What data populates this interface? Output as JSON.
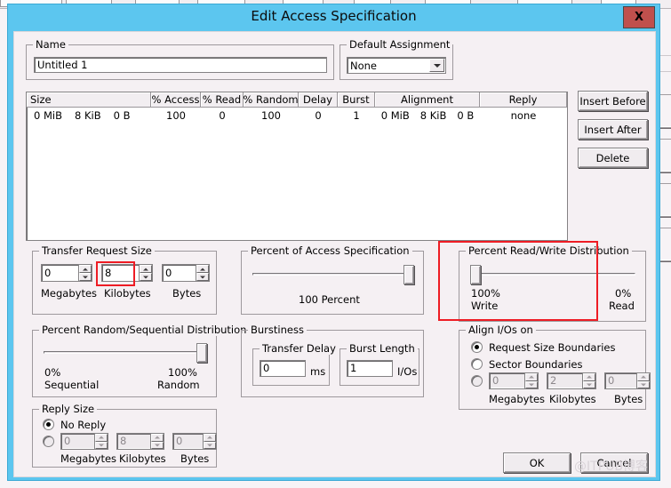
{
  "window": {
    "title": "Edit Access Specification",
    "close_label": "X",
    "titlebar_color": "#5cc6ef",
    "body_color": "#f5f0f3",
    "annotation_color": "#ee1c24",
    "close_button_color": "#c0504d"
  },
  "name_group": {
    "legend": "Name",
    "value": "Untitled 1"
  },
  "default_assignment_group": {
    "legend": "Default Assignment",
    "selected": "None",
    "options": [
      "None"
    ]
  },
  "spec_list": {
    "columns": [
      "Size",
      "% Access",
      "% Read",
      "% Random",
      "Delay",
      "Burst",
      "Alignment",
      "Reply"
    ],
    "rows": [
      {
        "size": [
          "0 MiB",
          "8 KiB",
          "0 B"
        ],
        "access": "100",
        "read": "0",
        "random": "100",
        "delay": "0",
        "burst": "1",
        "alignment": [
          "0 MiB",
          "8 KiB",
          "0 B"
        ],
        "reply": "none"
      }
    ]
  },
  "side_buttons": {
    "insert_before": "Insert Before",
    "insert_after": "Insert After",
    "delete": "Delete"
  },
  "transfer_request_size": {
    "legend": "Transfer Request Size",
    "megabytes_value": "0",
    "kilobytes_value": "8",
    "bytes_value": "0",
    "megabytes_label": "Megabytes",
    "kilobytes_label": "Kilobytes",
    "bytes_label": "Bytes"
  },
  "percent_of_access": {
    "legend": "Percent of Access Specification",
    "value_label": "100 Percent",
    "slider_percent": 100
  },
  "percent_read_write": {
    "legend": "Percent Read/Write Distribution",
    "left_percent": "100%",
    "left_label": "Write",
    "right_percent": "0%",
    "right_label": "Read",
    "slider_percent": 0
  },
  "percent_random_sequential": {
    "legend": "Percent Random/Sequential Distribution",
    "left_percent": "0%",
    "left_label": "Sequential",
    "right_percent": "100%",
    "right_label": "Random",
    "slider_percent": 100
  },
  "burstiness": {
    "legend": "Burstiness",
    "transfer_delay_legend": "Transfer Delay",
    "transfer_delay_value": "0",
    "transfer_delay_unit": "ms",
    "burst_length_legend": "Burst Length",
    "burst_length_value": "1",
    "burst_length_unit": "I/Os"
  },
  "align_ios": {
    "legend": "Align I/Os on",
    "option_request_size": "Request Size Boundaries",
    "option_sector": "Sector Boundaries",
    "option_custom": "",
    "selected": "request_size",
    "megabytes_value": "0",
    "kilobytes_value": "2",
    "bytes_value": "0",
    "megabytes_label": "Megabytes",
    "kilobytes_label": "Kilobytes",
    "bytes_label": "Bytes"
  },
  "reply_size": {
    "legend": "Reply Size",
    "option_no_reply": "No Reply",
    "selected": "no_reply",
    "megabytes_value": "0",
    "kilobytes_value": "8",
    "bytes_value": "0",
    "megabytes_label": "Megabytes",
    "kilobytes_label": "Kilobytes",
    "bytes_label": "Bytes"
  },
  "footer": {
    "ok": "OK",
    "cancel": "Cancel"
  },
  "watermark": "@ITPUB博客"
}
